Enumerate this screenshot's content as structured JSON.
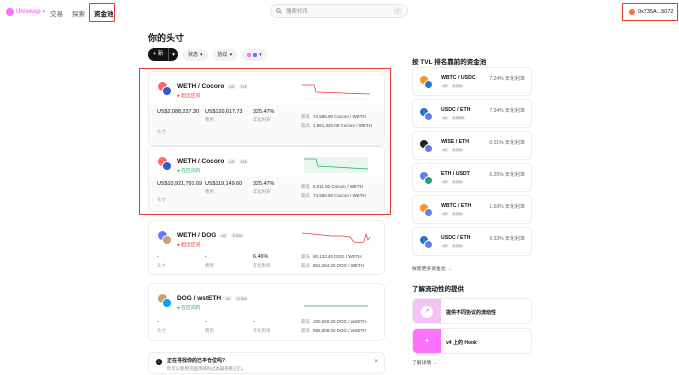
{
  "nav": {
    "logo": "Uniswap",
    "links": [
      "交易",
      "探索",
      "资金池"
    ],
    "search_placeholder": "搜索代币",
    "search_shortcut": "/",
    "wallet": "0x735A...5072"
  },
  "page": {
    "title": "你的头寸",
    "new_button": "+ 新",
    "filters": [
      "状态",
      "协议"
    ]
  },
  "positions": [
    {
      "pair": "WETH / Cocoro",
      "version": "v3",
      "fee": "1%",
      "status": "超出区间",
      "status_kind": "out",
      "size": "US$2,088,237.30",
      "size_label": "头寸",
      "fees": "US$120,617.73",
      "fees_label": "费用",
      "apr": "325.47%",
      "apr_label": "年化利率",
      "min_label": "最低",
      "min": "74,565.90 Cocoro / WETH",
      "max_label": "最高",
      "max": "1,961,320.00 Cocoro / WETH"
    },
    {
      "pair": "WETH / Cocoro",
      "version": "v3",
      "fee": "1%",
      "status": "在区间内",
      "status_kind": "in",
      "size": "US$10,921,791.69",
      "size_label": "头寸",
      "fees": "US$119,149.60",
      "fees_label": "费用",
      "apr": "325.47%",
      "apr_label": "年化利率",
      "min_label": "最低",
      "min": "5,011.92 Cocoro / WETH",
      "max_label": "最高",
      "max": "74,565.90 Cocoro / WETH"
    },
    {
      "pair": "WETH / DOG",
      "version": "v2",
      "fee": "0.3%",
      "status": "超出区间",
      "status_kind": "out",
      "size": "-",
      "size_label": "头寸",
      "fees": "-",
      "fees_label": "费用",
      "apr": "6.46%",
      "apr_label": "年化利率",
      "min_label": "最低",
      "min": "90,132.40 DOG / WETH",
      "max_label": "最高",
      "max": "862,264.00 DOG / WETH"
    },
    {
      "pair": "DOG / wstETH",
      "version": "v2",
      "fee": "0.3%",
      "status": "在区间内",
      "status_kind": "in",
      "size": "-",
      "size_label": "头寸",
      "fees": "-",
      "fees_label": "费用",
      "apr": "-",
      "apr_label": "年化利率",
      "min_label": "最低",
      "min": "100,050.00 DOG / wstETH",
      "max_label": "最高",
      "max": "995,809.00 DOG / wstETH"
    }
  ],
  "info": {
    "title": "正在寻找你的已平仓位吗?",
    "subtitle": "你可以使用页面顶部的过滤器查看它们。",
    "close": "×"
  },
  "sidebar": {
    "title": "按 TVL 排名靠前的资金池",
    "pools": [
      {
        "pair": "WBTC / USDC",
        "version": "v3",
        "fee": "0.3%",
        "apr": "7.24% 年化利率",
        "color_a": "#f7931a",
        "color_b": "#2775ca"
      },
      {
        "pair": "USDC / ETH",
        "version": "v4",
        "fee": "0.05%",
        "apr": "7.34% 年化利率",
        "color_a": "#2775ca",
        "color_b": "#627eea"
      },
      {
        "pair": "WISE / ETH",
        "version": "v2",
        "fee": "0.3%",
        "apr": "0.01% 年化利率",
        "color_a": "#222222",
        "color_b": "#627eea"
      },
      {
        "pair": "ETH / USDT",
        "version": "v3",
        "fee": "0.3%",
        "apr": "6.25% 年化利率",
        "color_a": "#627eea",
        "color_b": "#26a17b"
      },
      {
        "pair": "WBTC / ETH",
        "version": "v3",
        "fee": "0.3%",
        "apr": "1.59% 年化利率",
        "color_a": "#f7931a",
        "color_b": "#627eea"
      },
      {
        "pair": "USDC / ETH",
        "version": "v3",
        "fee": "0.3%",
        "apr": "9.33% 年化利率",
        "color_a": "#2775ca",
        "color_b": "#627eea"
      }
    ],
    "explore_more": "探索更多资金池",
    "learn_title": "了解流动性的提供",
    "learn_items": [
      "提供不同协议的流动性",
      "v4 上的 Hook"
    ],
    "learn_more": "了解详情"
  }
}
